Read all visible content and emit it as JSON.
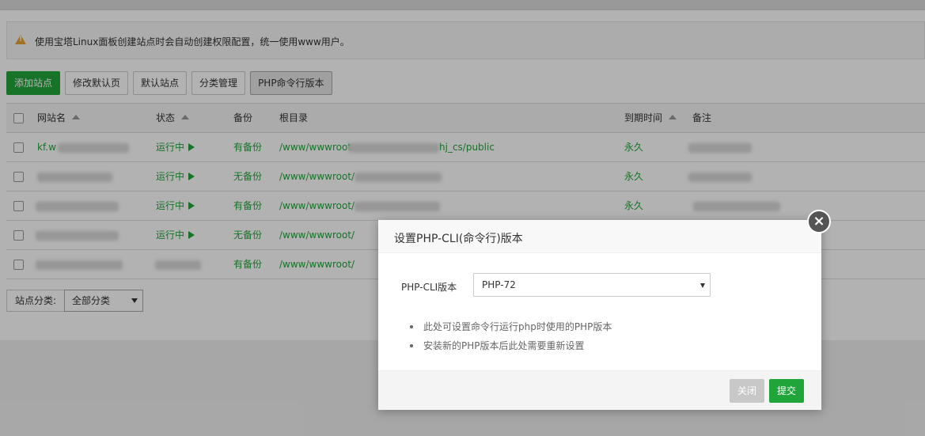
{
  "alert": {
    "text": "使用宝塔Linux面板创建站点时会自动创建权限配置，统一使用www用户。"
  },
  "toolbar": {
    "add_site": "添加站点",
    "modify_default_page": "修改默认页",
    "default_site": "默认站点",
    "category_manage": "分类管理",
    "php_cli_version": "PHP命令行版本"
  },
  "table": {
    "headers": {
      "site_name": "网站名",
      "status": "状态",
      "backup": "备份",
      "root_dir": "根目录",
      "expire": "到期时间",
      "remark": "备注"
    },
    "rows": [
      {
        "name": "kf.w",
        "status": "运行中",
        "backup": "有备份",
        "root": "/www/wwwroot",
        "root_tail": "hj_cs/public",
        "expire": "永久"
      },
      {
        "name": "",
        "status": "运行中",
        "backup": "无备份",
        "root": "/www/wwwroot/",
        "root_tail": "",
        "expire": "永久"
      },
      {
        "name": "",
        "status": "运行中",
        "backup": "有备份",
        "root": "/www/wwwroot/",
        "root_tail": "",
        "expire": "永久"
      },
      {
        "name": "",
        "status": "运行中",
        "backup": "无备份",
        "root": "/www/wwwroot/",
        "root_tail": "",
        "expire": ""
      },
      {
        "name": "",
        "status": "",
        "backup": "有备份",
        "root": "/www/wwwroot/",
        "root_tail": "",
        "expire": ""
      }
    ]
  },
  "category": {
    "label": "站点分类:",
    "selected": "全部分类"
  },
  "modal": {
    "title": "设置PHP-CLI(命令行)版本",
    "close_symbol": "×",
    "field_label": "PHP-CLI版本",
    "selected_version": "PHP-72",
    "tips": [
      "此处可设置命令行运行php时使用的PHP版本",
      "安装新的PHP版本后此处需要重新设置"
    ],
    "btn_close": "关闭",
    "btn_submit": "提交"
  },
  "colors": {
    "accent_green": "#20a53a",
    "warning": "#e8a234"
  }
}
